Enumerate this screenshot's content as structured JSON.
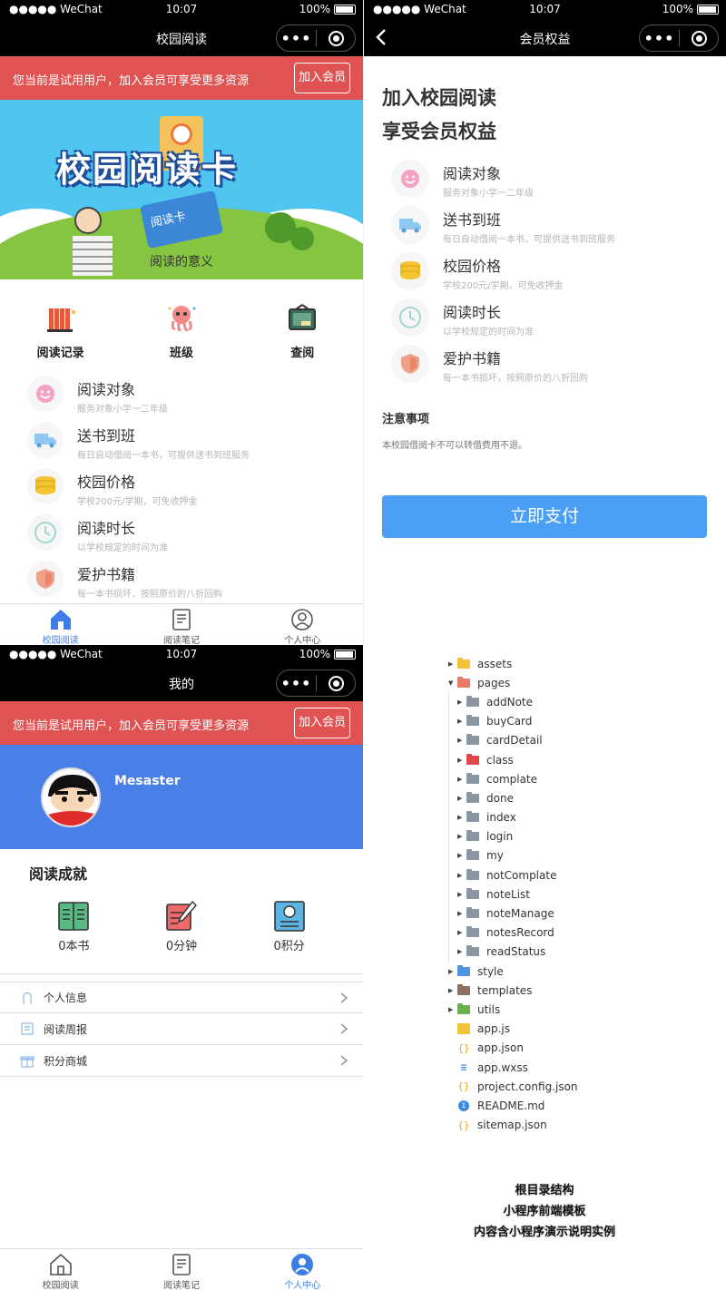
{
  "status_bar": {
    "carrier": "●●●●● WeChat",
    "time": "10:07",
    "battery": "100%"
  },
  "home": {
    "title": "校园阅读",
    "trial_text": "您当前是试用用户，加入会员可享受更多资源",
    "join_label": "加入会员",
    "hero": {
      "title": "校园阅读卡",
      "card_text": "阅读卡",
      "subtitle": "阅读的意义"
    },
    "quick_menu": [
      {
        "label": "阅读记录",
        "icon": "books-shelf-icon"
      },
      {
        "label": "班级",
        "icon": "octopus-icon"
      },
      {
        "label": "查阅",
        "icon": "picture-frame-icon"
      }
    ],
    "benefits": [
      {
        "title": "阅读对象",
        "desc": "服务对象小学一二年级",
        "icon": "smile-face-icon"
      },
      {
        "title": "送书到班",
        "desc": "每日自动借阅一本书，可提供送书到班服务",
        "icon": "delivery-truck-icon"
      },
      {
        "title": "校园价格",
        "desc": "学校200元/学期，可免收押金",
        "icon": "coins-icon"
      },
      {
        "title": "阅读时长",
        "desc": "以学校规定的时间为准",
        "icon": "clock-icon"
      },
      {
        "title": "爱护书籍",
        "desc": "每一本书损坏，按照原价的八折回购",
        "icon": "shield-icon"
      }
    ]
  },
  "tabs": [
    {
      "label": "校园阅读",
      "icon": "home-icon"
    },
    {
      "label": "阅读笔记",
      "icon": "notes-icon"
    },
    {
      "label": "个人中心",
      "icon": "user-icon"
    }
  ],
  "member": {
    "title": "会员权益",
    "heading_line1": "加入校园阅读",
    "heading_line2": "享受会员权益",
    "notes_title": "注意事项",
    "notes_text": "本校园借阅卡不可以转借费用不退。",
    "pay_label": "立即支付"
  },
  "profile": {
    "title": "我的",
    "username": "Mesaster",
    "achievement_title": "阅读成就",
    "achievements": [
      {
        "label": "0本书",
        "icon": "book-icon"
      },
      {
        "label": "0分钟",
        "icon": "pen-note-icon"
      },
      {
        "label": "0积分",
        "icon": "badge-icon"
      }
    ],
    "menu": [
      {
        "label": "个人信息",
        "icon": "person-icon"
      },
      {
        "label": "阅读周报",
        "icon": "report-icon"
      },
      {
        "label": "积分商城",
        "icon": "gift-icon"
      }
    ]
  },
  "file_tree": {
    "root_items": [
      "assets",
      "pages"
    ],
    "pages_children": [
      "addNote",
      "buyCard",
      "cardDetail",
      "class",
      "complate",
      "done",
      "index",
      "login",
      "my",
      "notComplate",
      "noteList",
      "noteManage",
      "notesRecord",
      "readStatus"
    ],
    "folders_after": [
      "style",
      "templates",
      "utils"
    ],
    "files": [
      {
        "name": "app.js",
        "glyph": "JS"
      },
      {
        "name": "app.json",
        "glyph": "{}"
      },
      {
        "name": "app.wxss",
        "glyph": "≡"
      },
      {
        "name": "project.config.json",
        "glyph": "{}"
      },
      {
        "name": "README.md",
        "glyph": "i"
      },
      {
        "name": "sitemap.json",
        "glyph": "{}"
      }
    ],
    "caption_line1": "根目录结构",
    "caption_line2": "小程序前端模板",
    "caption_line3": "内容含小程序演示说明实例"
  }
}
